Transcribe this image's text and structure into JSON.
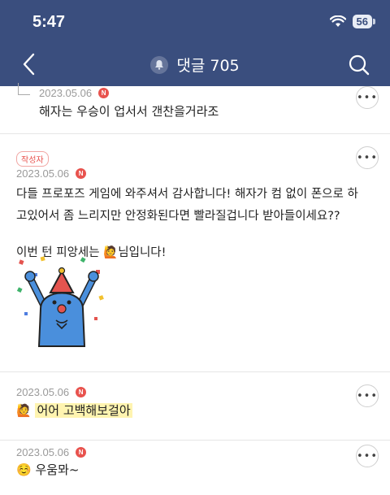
{
  "status_bar": {
    "time": "5:47",
    "battery": "56"
  },
  "header": {
    "title": "댓글 705"
  },
  "comments": [
    {
      "date": "2023.05.06",
      "badge": "N",
      "text": "해자는 우승이 업서서 갠찬을거라조",
      "more": "•••"
    },
    {
      "author_label": "작성자",
      "date": "2023.05.06",
      "badge": "N",
      "line1": "다들 프로포즈 게임에 와주셔서 감사합니다! 해자가 컴 없이 폰으로 하",
      "line2": "고있어서 좀 느리지만 안정화된다면 빨라질겁니다 받아들이세요??",
      "line3_pre": "이번 턴 피앙세는 ",
      "line3_post": "님입니다!",
      "more": "•••"
    },
    {
      "date": "2023.05.06",
      "badge": "N",
      "text": "어어 고백해보걸아",
      "more": "•••"
    },
    {
      "date": "2023.05.06",
      "badge": "N",
      "text": "우움뫄~",
      "more": "•••"
    }
  ],
  "icons": {
    "person_raising_hand": "🙋",
    "smiling_face": "☺️"
  },
  "colors": {
    "header_bg": "#3a4e7e",
    "badge_red": "#e8534e",
    "highlight": "#fff4b0"
  }
}
